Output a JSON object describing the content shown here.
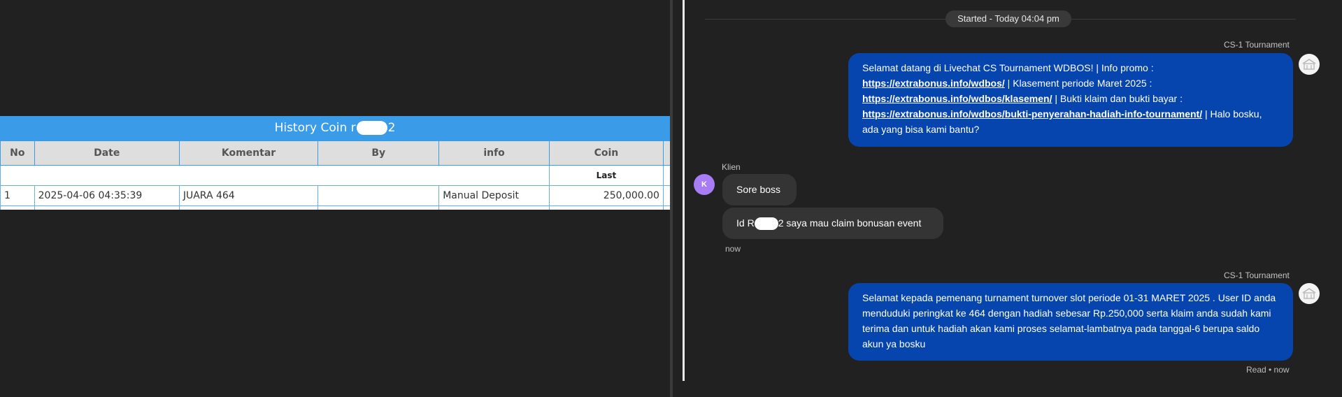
{
  "history": {
    "title_prefix": "History Coin r",
    "title_suffix": "2",
    "columns": [
      "No",
      "Date",
      "Komentar",
      "By",
      "info",
      "Coin"
    ],
    "subheader": "Last",
    "rows": [
      {
        "no": "1",
        "date": "2025-04-06 04:35:39",
        "komentar": "JUARA 464",
        "by": "",
        "info": "Manual Deposit",
        "coin": "250,000.00"
      }
    ]
  },
  "chat": {
    "started_label": "Started - Today 04:04 pm",
    "agent_name": "CS-1 Tournament",
    "customer_name": "Klien",
    "customer_initial": "K",
    "message1": {
      "t1": "Selamat datang di Livechat CS Tournament WDBOS! | Info promo :",
      "link1": "https://extrabonus.info/wdbos/",
      "t2": " | Klasement periode Maret 2025 :",
      "link2": "https://extrabonus.info/wdbos/klasemen/",
      "t3": " | Bukti klaim dan bukti bayar :",
      "link3": "https://extrabonus.info/wdbos/bukti-penyerahan-hadiah-info-tournament/",
      "t4": " | Halo bosku, ada yang bisa kami bantu?"
    },
    "user_msg1": "Sore boss",
    "user_msg2_prefix": "Id R",
    "user_msg2_suffix": "2 saya mau claim bonusan event",
    "user_time": "now",
    "message2": "Selamat kepada pemenang turnament turnover slot periode 01-31 MARET 2025 . User ID anda menduduki peringkat ke 464 dengan hadiah sebesar Rp.250,000 serta klaim anda sudah kami terima dan untuk hadiah akan kami proses selamat-lambatnya pada tanggal-6 berupa saldo akun ya bosku",
    "read_status": "Read • now"
  },
  "colors": {
    "table_header_blue": "#3a9be8",
    "agent_bubble": "#0645ad",
    "customer_avatar": "#a87cf5",
    "coin_green": "#1f9a2b"
  }
}
